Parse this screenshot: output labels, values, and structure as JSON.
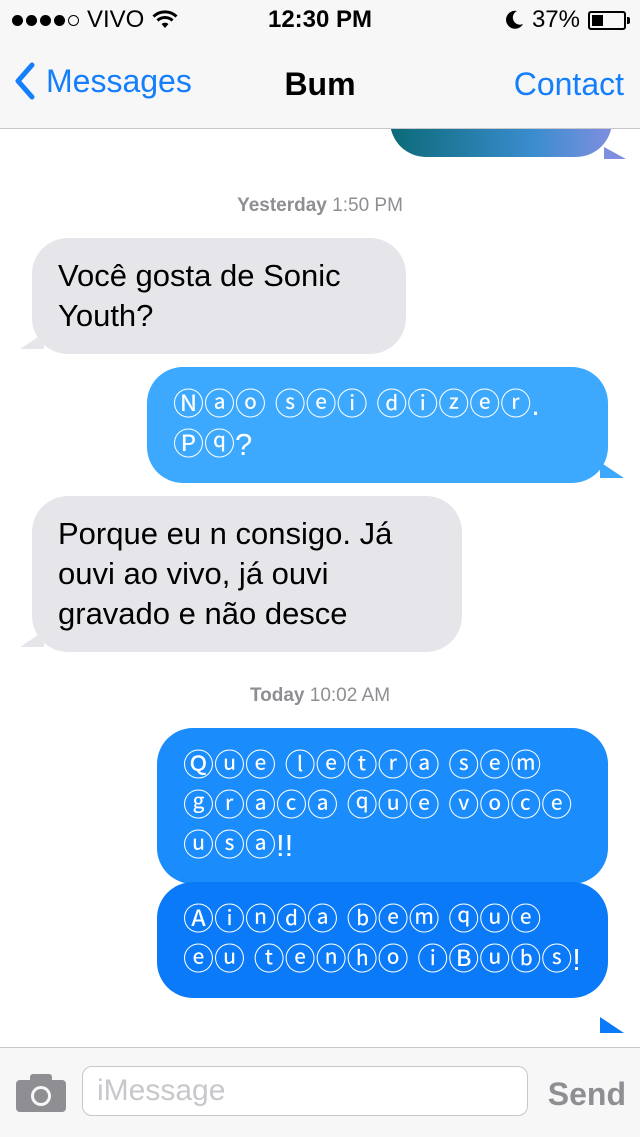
{
  "status_bar": {
    "carrier": "VIVO",
    "time": "12:30 PM",
    "battery_percent": "37%",
    "battery_level": 0.37,
    "signal_bars_filled": 4,
    "signal_bars_total": 5,
    "icons": [
      "signal-dots-icon",
      "wifi-icon",
      "moon-icon",
      "battery-icon"
    ]
  },
  "nav": {
    "back_label": "Messages",
    "title": "Bum",
    "contact_label": "Contact",
    "back_icon": "chevron-left-icon"
  },
  "conversation": {
    "timestamps": [
      {
        "day": "Yesterday",
        "time": "1:50 PM"
      },
      {
        "day": "Today",
        "time": "10:02 AM"
      }
    ],
    "messages": [
      {
        "direction": "incoming",
        "text": "Você gosta de Sonic Youth?"
      },
      {
        "direction": "outgoing",
        "text": "Ⓝⓐⓞ ⓢⓔⓘ ⓓⓘⓩⓔⓡ. Ⓟⓠ?"
      },
      {
        "direction": "incoming",
        "text": "Porque eu n consigo. Já ouvi ao vivo, já ouvi gravado e não desce"
      },
      {
        "direction": "outgoing",
        "text": "Ⓠⓤⓔ ⓛⓔⓣⓡⓐ ⓢⓔⓜ ⓖⓡⓐⓒⓐ ⓠⓤⓔ ⓥⓞⓒⓔ ⓤⓢⓐ!!"
      },
      {
        "direction": "outgoing",
        "text": "Ⓐⓘⓝⓓⓐ ⓑⓔⓜ ⓠⓤⓔ ⓔⓤ ⓣⓔⓝⓗⓞ ⓘⒷⓤⓑⓢ!"
      }
    ]
  },
  "input_bar": {
    "placeholder": "iMessage",
    "value": "",
    "send_label": "Send",
    "camera_icon": "camera-icon"
  },
  "colors": {
    "accent_blue": "#147efb",
    "incoming_bubble": "#e5e5ea",
    "outgoing_bubble_light": "#41b0ff",
    "outgoing_bubble_dark": "#0a7af9",
    "timestamp_gray": "#8e8e93"
  }
}
